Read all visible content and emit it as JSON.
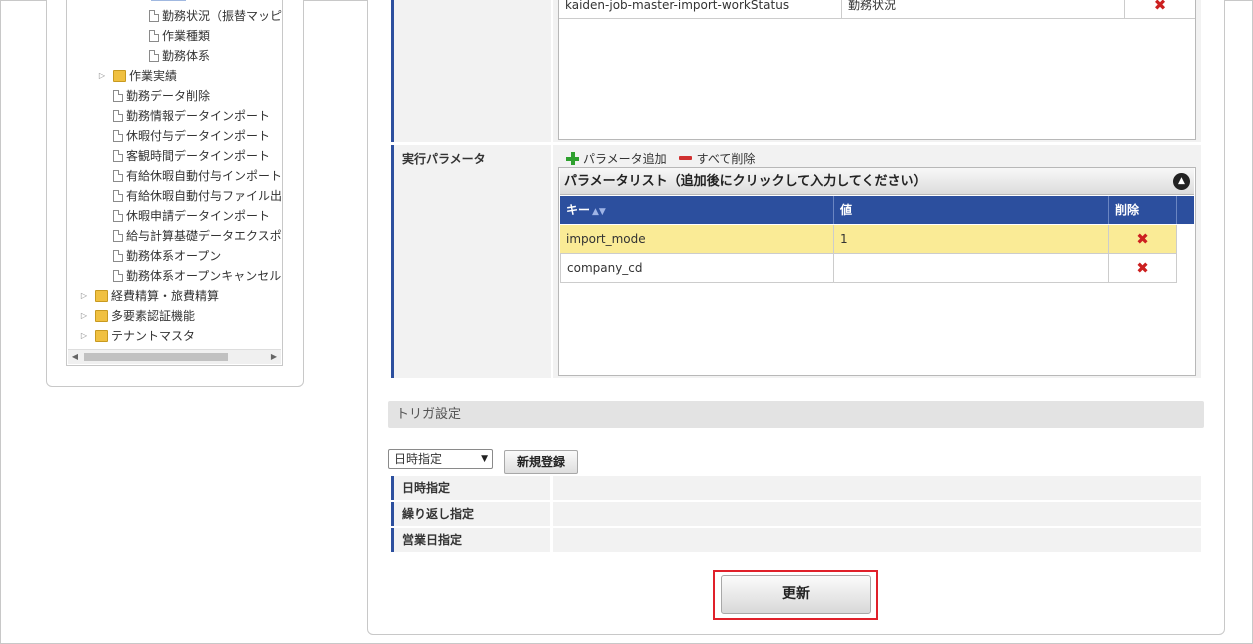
{
  "tree": {
    "items": [
      {
        "label": "勤務状況（振替マッピ",
        "type": "doc",
        "level": 3,
        "expander": false
      },
      {
        "label": "作業種類",
        "type": "doc",
        "level": 3,
        "expander": false
      },
      {
        "label": "勤務体系",
        "type": "doc",
        "level": 3,
        "expander": false
      },
      {
        "label": "作業実績",
        "type": "folder",
        "level": 2,
        "expander": true
      },
      {
        "label": "勤務データ削除",
        "type": "doc",
        "level": 2,
        "expander": false
      },
      {
        "label": "勤務情報データインポート",
        "type": "doc",
        "level": 2,
        "expander": false
      },
      {
        "label": "休暇付与データインポート",
        "type": "doc",
        "level": 2,
        "expander": false
      },
      {
        "label": "客観時間データインポート",
        "type": "doc",
        "level": 2,
        "expander": false
      },
      {
        "label": "有給休暇自動付与インポート",
        "type": "doc",
        "level": 2,
        "expander": false
      },
      {
        "label": "有給休暇自動付与ファイル出",
        "type": "doc",
        "level": 2,
        "expander": false
      },
      {
        "label": "休暇申請データインポート",
        "type": "doc",
        "level": 2,
        "expander": false
      },
      {
        "label": "給与計算基礎データエクスポ",
        "type": "doc",
        "level": 2,
        "expander": false
      },
      {
        "label": "勤務体系オープン",
        "type": "doc",
        "level": 2,
        "expander": false
      },
      {
        "label": "勤務体系オープンキャンセル",
        "type": "doc",
        "level": 2,
        "expander": false
      },
      {
        "label": "経費精算・旅費精算",
        "type": "folder",
        "level": 1,
        "expander": true
      },
      {
        "label": "多要素認証機能",
        "type": "folder",
        "level": 1,
        "expander": true
      },
      {
        "label": "テナントマスタ",
        "type": "folder",
        "level": 1,
        "expander": true
      }
    ]
  },
  "job_list": {
    "row": {
      "key": "kaiden-job-master-import-workStatus",
      "value": "勤務状況"
    }
  },
  "params": {
    "label": "実行パラメータ",
    "add_label": "パラメータ追加",
    "delete_all_label": "すべて削除",
    "list_title": "パラメータリスト（追加後にクリックして入力してください）",
    "columns": {
      "key": "キー",
      "value": "値",
      "delete": "削除"
    },
    "rows": [
      {
        "key": "import_mode",
        "value": "1",
        "highlighted": true
      },
      {
        "key": "company_cd",
        "value": "",
        "highlighted": false
      }
    ]
  },
  "trigger": {
    "section_title": "トリガ設定",
    "select_value": "日時指定",
    "new_button": "新規登録",
    "rows": [
      "日時指定",
      "繰り返し指定",
      "営業日指定"
    ]
  },
  "update_button": "更新",
  "colors": {
    "accent": "#2c4f9e",
    "highlight_row": "#faeb96",
    "delete": "#cc2020",
    "focus_outline": "#e0202a"
  }
}
